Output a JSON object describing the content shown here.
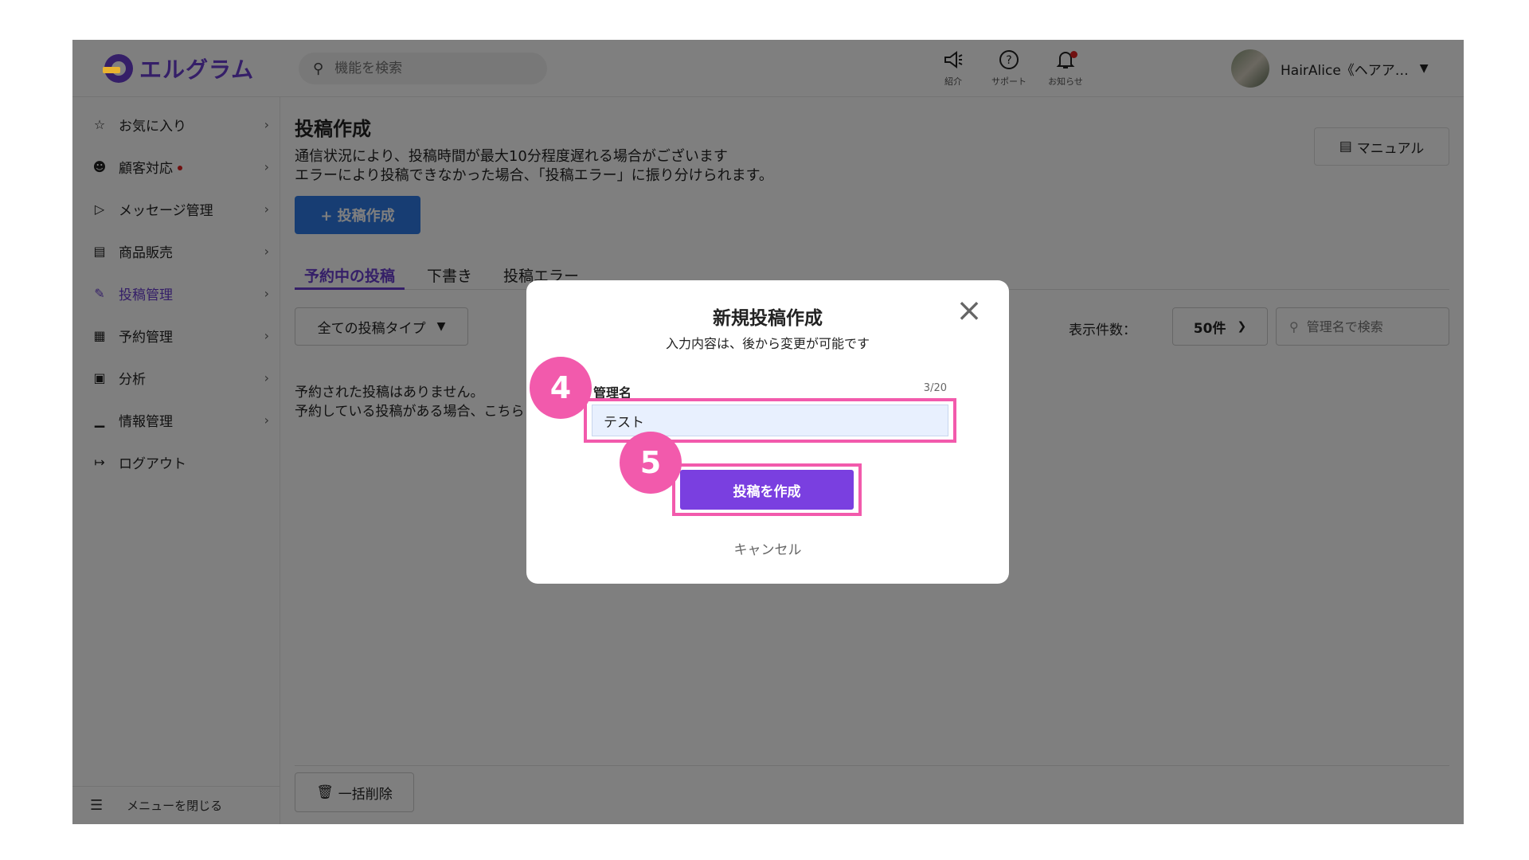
{
  "header": {
    "logo_text": "エルグラム",
    "search_placeholder": "機能を検索",
    "buttons": [
      {
        "label": "紹介",
        "icon": "megaphone-icon"
      },
      {
        "label": "サポート",
        "icon": "help-icon"
      },
      {
        "label": "お知らせ",
        "icon": "bell-icon"
      }
    ],
    "account_name": "HairAlice《ヘアア…"
  },
  "sidebar": {
    "items": [
      {
        "label": "お気に入り",
        "icon": "star-icon"
      },
      {
        "label": "顧客対応",
        "icon": "user-icon"
      },
      {
        "label": "メッセージ管理",
        "icon": "send-icon"
      },
      {
        "label": "商品販売",
        "icon": "store-icon"
      },
      {
        "label": "投稿管理",
        "icon": "edit-icon"
      },
      {
        "label": "予約管理",
        "icon": "calendar-icon"
      },
      {
        "label": "分析",
        "icon": "report-icon"
      },
      {
        "label": "情報管理",
        "icon": "chart-icon"
      },
      {
        "label": "ログアウト",
        "icon": "logout-icon"
      }
    ],
    "collapse_label": "メニューを閉じる"
  },
  "main": {
    "title": "投稿作成",
    "notice_lines": [
      "通信状況により、投稿時間が最大10分程度遅れる場合がございます",
      "エラーにより投稿できなかった場合、「投稿エラー」に振り分けられます。"
    ],
    "manual_label": "マニュアル",
    "create_label": "+ 投稿作成",
    "tabs": [
      "予約中の投稿",
      "下書き",
      "投稿エラー"
    ],
    "type_filter": "全ての投稿タイプ",
    "count_label": "表示件数：",
    "count_value": "50件",
    "name_search_placeholder": "管理名で検索",
    "empty_lines": [
      "予約された投稿はありません。",
      "予約している投稿がある場合、こちら"
    ],
    "bulk_delete_label": "一括削除"
  },
  "modal": {
    "title": "新規投稿作成",
    "subtitle": "入力内容は、後から変更が可能です",
    "field_label": "管理名",
    "field_count": "3/20",
    "field_value": "テスト",
    "create_button": "投稿を作成",
    "cancel": "キャンセル"
  },
  "steps": [
    "4",
    "5"
  ],
  "colors": {
    "brand": "#6a3fd0",
    "primary_blue": "#2f7be6",
    "highlight_pink": "#f25aac",
    "modal_button": "#7a3fe0"
  }
}
